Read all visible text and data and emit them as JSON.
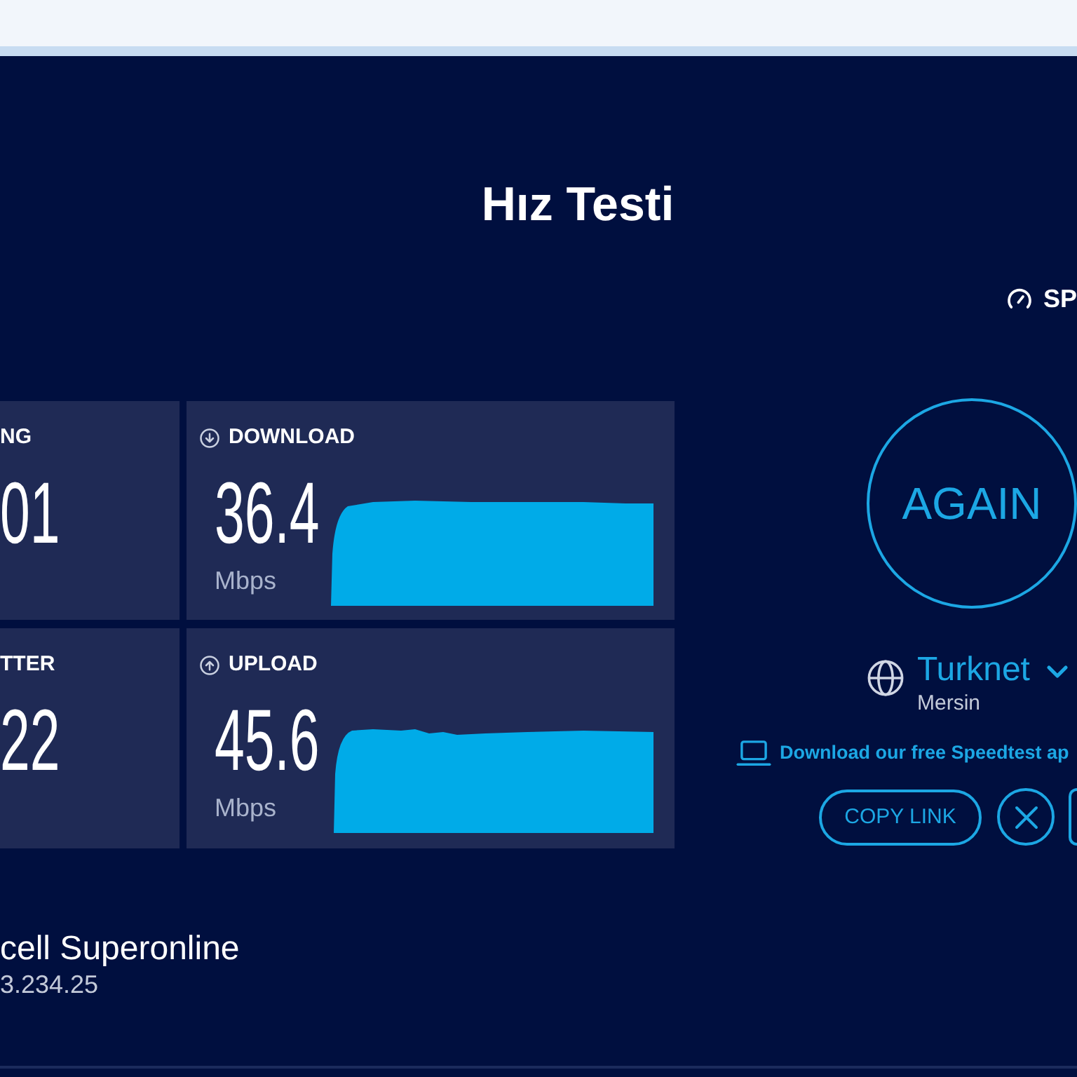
{
  "page": {
    "title": "Hız Testi",
    "logo_text": "SP"
  },
  "metrics": [
    {
      "kind": "latency",
      "label": "NG",
      "value": "01"
    },
    {
      "kind": "download",
      "label": "DOWNLOAD",
      "value": "36.4",
      "unit": "Mbps"
    },
    {
      "kind": "latency",
      "label": "TTER",
      "value": "22"
    },
    {
      "kind": "upload",
      "label": "UPLOAD",
      "value": "45.6",
      "unit": "Mbps"
    }
  ],
  "test_button": {
    "label": "AGAIN"
  },
  "server": {
    "name": "Turknet",
    "location": "Mersin"
  },
  "app_link": {
    "label": "Download our free Speedtest ap"
  },
  "share": {
    "copy_label": "COPY LINK"
  },
  "connection": {
    "isp": "cell Superonline",
    "ip": "3.234.25"
  }
}
